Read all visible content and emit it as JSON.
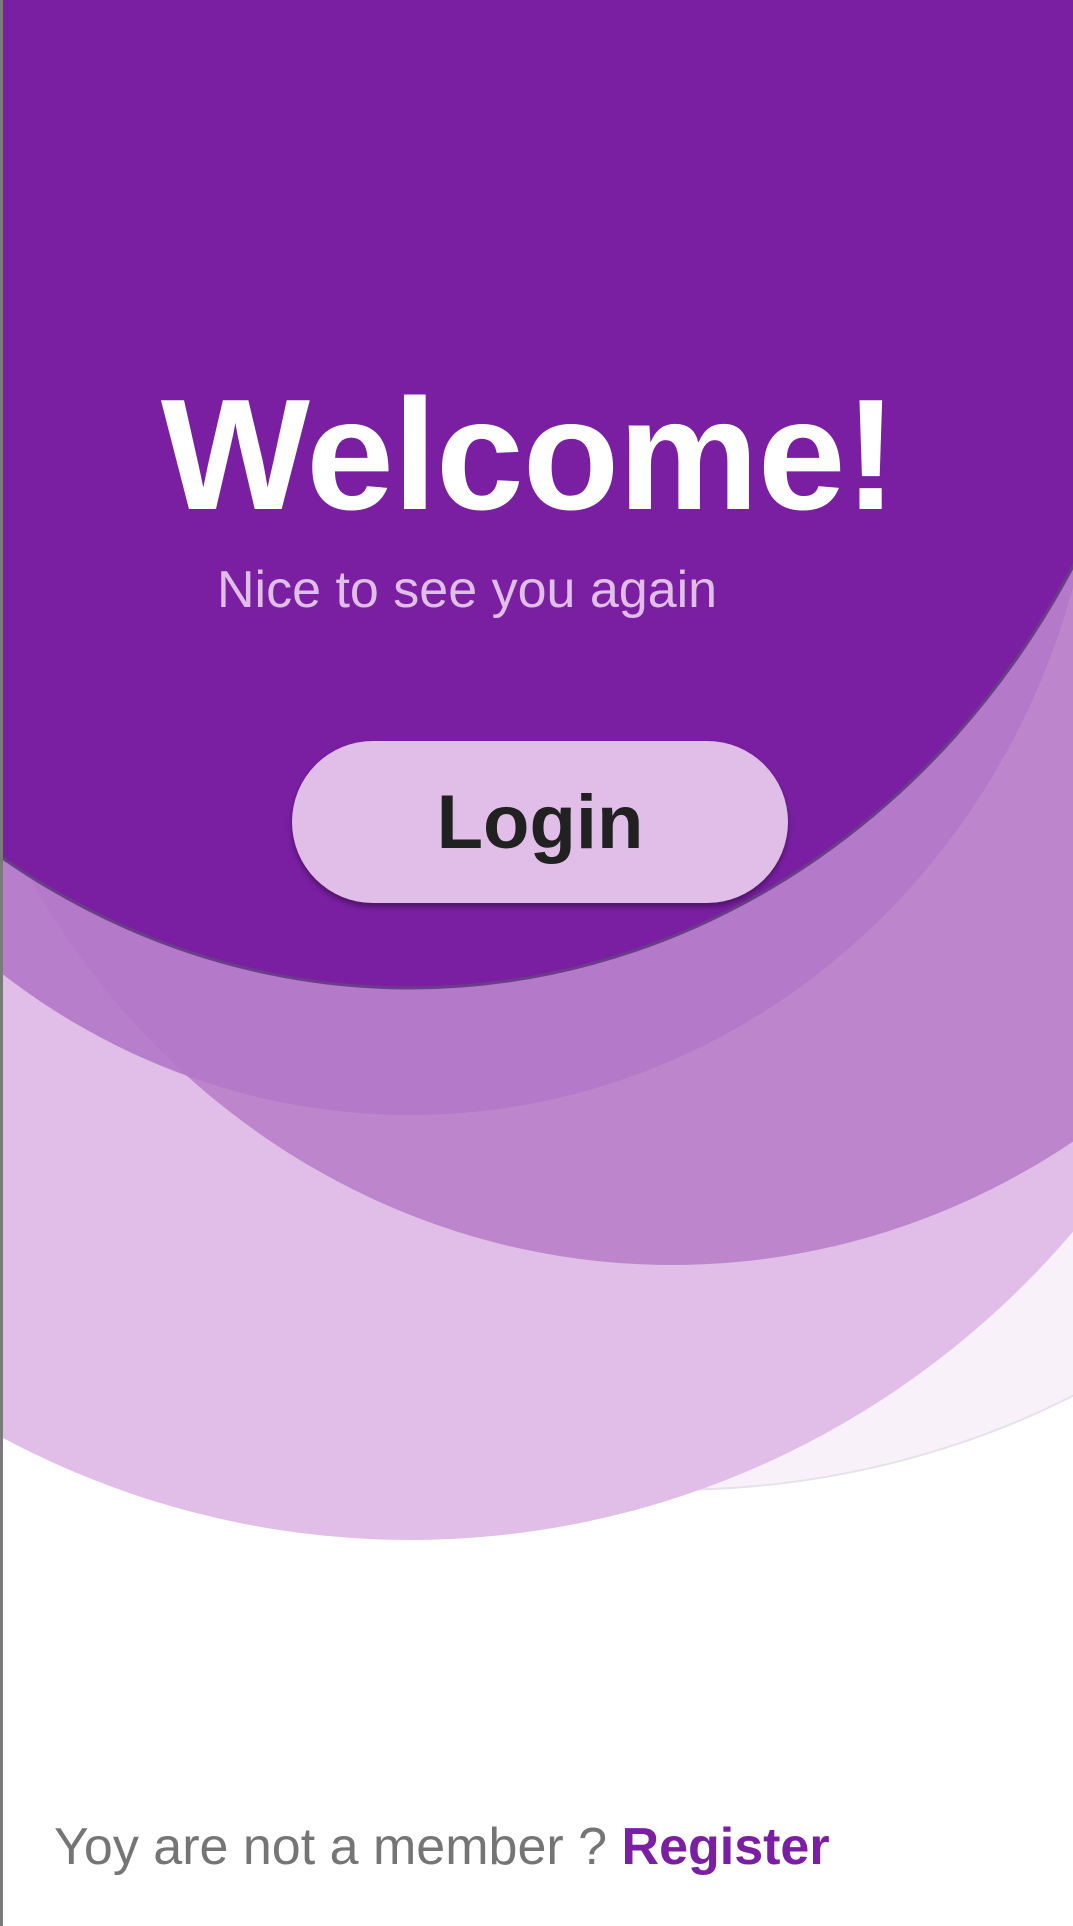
{
  "welcome": {
    "title": "Welcome!",
    "subtitle": "Nice to see you again"
  },
  "login": {
    "label": "Login"
  },
  "footer": {
    "prompt": "Yoy are not a member ? ",
    "register_label": "Register"
  },
  "colors": {
    "primary": "#7b1fa2",
    "header_purple": "#7a1fa2",
    "mid_purple": "#b27dc8",
    "light_purple": "#e1bee7",
    "pale_purple": "#f8f1f9",
    "text_grey": "#757575",
    "button_text": "#212121"
  }
}
